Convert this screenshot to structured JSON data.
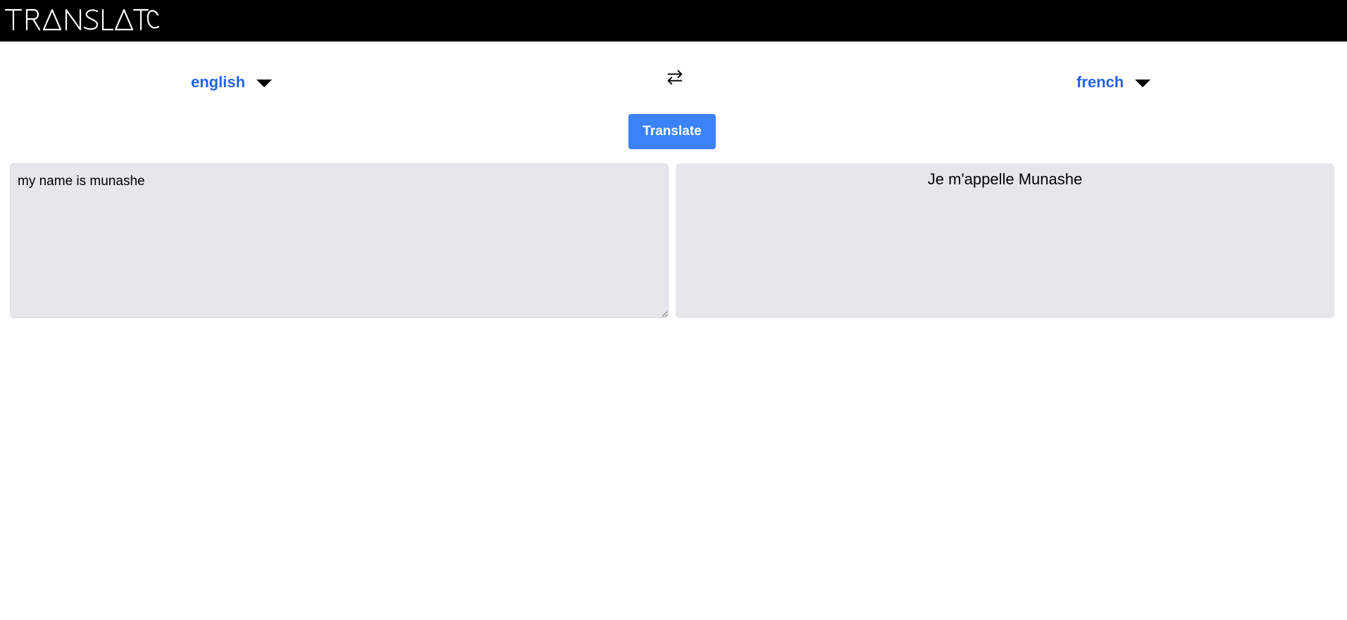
{
  "header": {
    "logo_text": "TRANSLATE"
  },
  "languages": {
    "source": "english",
    "target": "french",
    "swap_icon": "swap-arrows-icon",
    "caret_icon": "caret-down-icon",
    "accent_color": "#2563eb"
  },
  "actions": {
    "translate_label": "Translate",
    "button_color": "#3b82f6"
  },
  "input": {
    "value": "my name is munashe"
  },
  "output": {
    "value": "Je m'appelle Munashe"
  }
}
